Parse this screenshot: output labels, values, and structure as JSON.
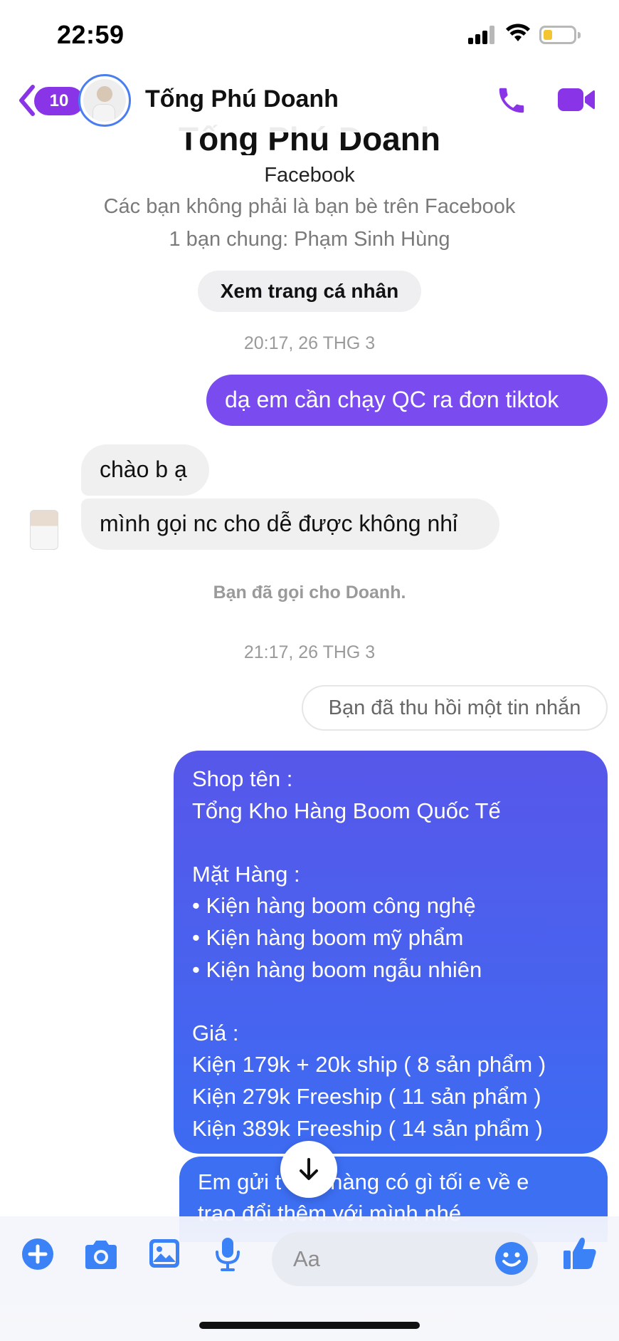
{
  "status_bar": {
    "time": "22:59"
  },
  "header": {
    "back_badge": "10",
    "contact_name": "Tống Phú Doanh",
    "icons": [
      "back-chevron-icon",
      "phone-icon",
      "video-camera-icon"
    ]
  },
  "profile": {
    "name": "Tống Phú Doanh",
    "app": "Facebook",
    "friend_note": "Các bạn không phải là bạn bè trên Facebook",
    "mutual": "1 bạn chung: Phạm Sinh Hùng",
    "view_profile_label": "Xem trang cá nhân"
  },
  "messages": {
    "ts1": "20:17, 26 THG 3",
    "out1": "dạ em cần chạy QC  ra đơn tiktok",
    "in1": "chào b ạ",
    "in2": "mình gọi nc cho dễ được không nhỉ",
    "call_note": "Bạn đã gọi cho Doanh.",
    "ts2": "21:17, 26 THG 3",
    "recalled": "Bạn đã thu hồi một tin nhắn",
    "shop_message": "Shop tên :\nTổng Kho Hàng Boom Quốc Tế\n\nMặt Hàng :\n• Kiện hàng boom công nghệ\n• Kiện hàng boom mỹ phẩm\n• Kiện hàng boom ngẫu nhiên\n\nGiá :\nKiện 179k + 20k ship ( 8 sản phẩm )\nKiện 279k Freeship ( 11 sản phẩm )\nKiện 389k Freeship ( 14 sản phẩm )",
    "partial_message": "Em gửi t    ặt hàng có gì tối e về e\ntrao đổi thêm với mình nhé"
  },
  "composer": {
    "placeholder": "Aa",
    "icons": [
      "plus-icon",
      "camera-icon",
      "image-icon",
      "microphone-icon",
      "emoji-icon",
      "thumbs-up-icon"
    ]
  },
  "colors": {
    "accent": "#8a34e8",
    "outgoing_bubble": "#7a4cf0",
    "shop_bubble_top": "#5757ea",
    "shop_bubble_bottom": "#3d6bf2",
    "incoming_bubble": "#f0f0f0",
    "composer_icon": "#3b82f6"
  }
}
